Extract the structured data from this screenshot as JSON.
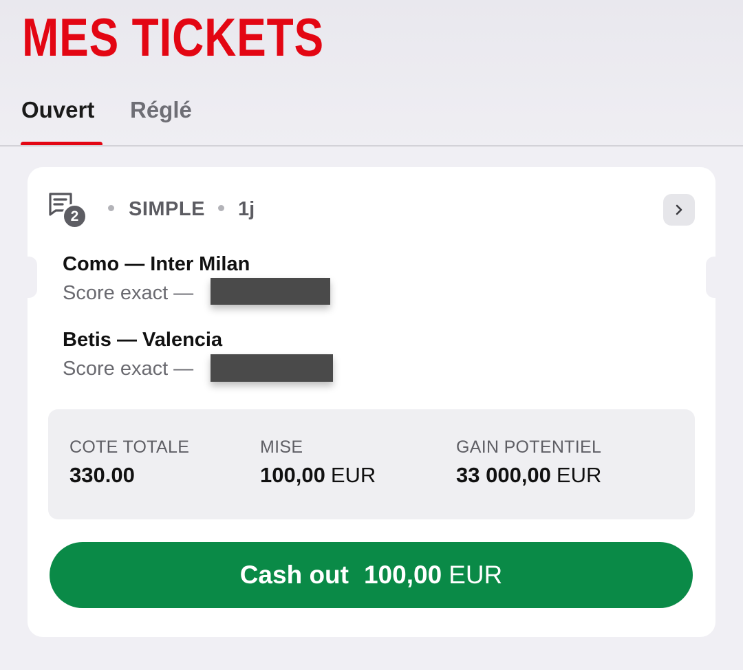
{
  "header": {
    "title": "MES TICKETS",
    "tabs": [
      {
        "label": "Ouvert",
        "active": true
      },
      {
        "label": "Réglé",
        "active": false
      }
    ]
  },
  "ticket": {
    "selection_count": "2",
    "bet_type": "SIMPLE",
    "age": "1j",
    "icons": {
      "ticket": "ticket-list-icon",
      "open": "chevron-right-icon"
    },
    "selections": [
      {
        "match": "Como — Inter Milan",
        "market": "Score exact —",
        "pick_redacted": true
      },
      {
        "match": "Betis — Valencia",
        "market": "Score exact —",
        "pick_redacted": true
      }
    ],
    "summary": {
      "odds_label": "COTE TOTALE",
      "odds_value": "330.00",
      "stake_label": "MISE",
      "stake_value": "100,00",
      "stake_currency": "EUR",
      "payout_label": "GAIN POTENTIEL",
      "payout_value": "33 000,00",
      "payout_currency": "EUR"
    },
    "cashout": {
      "label": "Cash out",
      "amount": "100,00",
      "currency": "EUR"
    }
  },
  "colors": {
    "brand_red": "#e30613",
    "cashout_green": "#0a8a47",
    "background": "#f0eff4"
  }
}
